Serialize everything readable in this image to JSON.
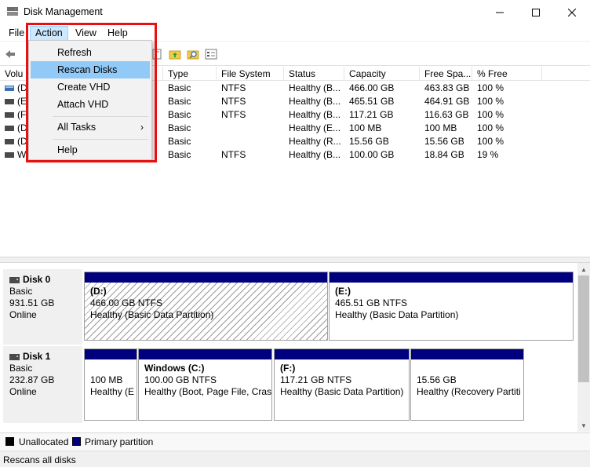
{
  "window": {
    "title": "Disk Management",
    "controls": {
      "minimize": "—",
      "maximize": "☐",
      "close": "✕"
    }
  },
  "menubar": {
    "items": [
      {
        "label": "File"
      },
      {
        "label": "Action"
      },
      {
        "label": "View"
      },
      {
        "label": "Help"
      }
    ]
  },
  "action_menu": {
    "items": [
      {
        "label": "Refresh"
      },
      {
        "label": "Rescan Disks"
      },
      {
        "label": "Create VHD"
      },
      {
        "label": "Attach VHD"
      },
      {
        "label": "All Tasks",
        "arrow": "›"
      },
      {
        "label": "Help"
      }
    ],
    "hovered": "Rescan Disks"
  },
  "volume_list": {
    "columns": [
      "Volu",
      "Type",
      "File System",
      "Status",
      "Capacity",
      "Free Spa...",
      "% Free"
    ],
    "rows": [
      {
        "vol": "(D",
        "type": "Basic",
        "fs": "NTFS",
        "status": "Healthy (B...",
        "capacity": "466.00 GB",
        "free": "463.83 GB",
        "pct": "100 %"
      },
      {
        "vol": "(E",
        "type": "Basic",
        "fs": "NTFS",
        "status": "Healthy (B...",
        "capacity": "465.51 GB",
        "free": "464.91 GB",
        "pct": "100 %"
      },
      {
        "vol": "(F",
        "type": "Basic",
        "fs": "NTFS",
        "status": "Healthy (B...",
        "capacity": "117.21 GB",
        "free": "116.63 GB",
        "pct": "100 %"
      },
      {
        "vol": "(D",
        "type": "Basic",
        "fs": "",
        "status": "Healthy (E...",
        "capacity": "100 MB",
        "free": "100 MB",
        "pct": "100 %"
      },
      {
        "vol": "(D",
        "type": "Basic",
        "fs": "",
        "status": "Healthy (R...",
        "capacity": "15.56 GB",
        "free": "15.56 GB",
        "pct": "100 %"
      },
      {
        "vol": "W",
        "type": "Basic",
        "fs": "NTFS",
        "status": "Healthy (B...",
        "capacity": "100.00 GB",
        "free": "18.84 GB",
        "pct": "19 %"
      }
    ]
  },
  "disks": [
    {
      "name": "Disk 0",
      "type": "Basic",
      "size": "931.51 GB",
      "state": "Online",
      "partitions": [
        {
          "name": "(D:)",
          "size": "466.00 GB NTFS",
          "status": "Healthy (Basic Data Partition)"
        },
        {
          "name": "(E:)",
          "size": "465.51 GB NTFS",
          "status": "Healthy (Basic Data Partition)"
        }
      ]
    },
    {
      "name": "Disk 1",
      "type": "Basic",
      "size": "232.87 GB",
      "state": "Online",
      "partitions": [
        {
          "name": "",
          "size": "100 MB",
          "status": "Healthy (E"
        },
        {
          "name": "Windows  (C:)",
          "size": "100.00 GB NTFS",
          "status": "Healthy (Boot, Page File, Cras"
        },
        {
          "name": "(F:)",
          "size": "117.21 GB NTFS",
          "status": "Healthy (Basic Data Partition)"
        },
        {
          "name": "",
          "size": "15.56 GB",
          "status": "Healthy (Recovery Partiti"
        }
      ]
    }
  ],
  "legend": {
    "unallocated": "Unallocated",
    "primary": "Primary partition",
    "colors": {
      "unallocated": "#000000",
      "primary": "#00007f"
    }
  },
  "statusbar": {
    "text": "Rescans all disks"
  }
}
